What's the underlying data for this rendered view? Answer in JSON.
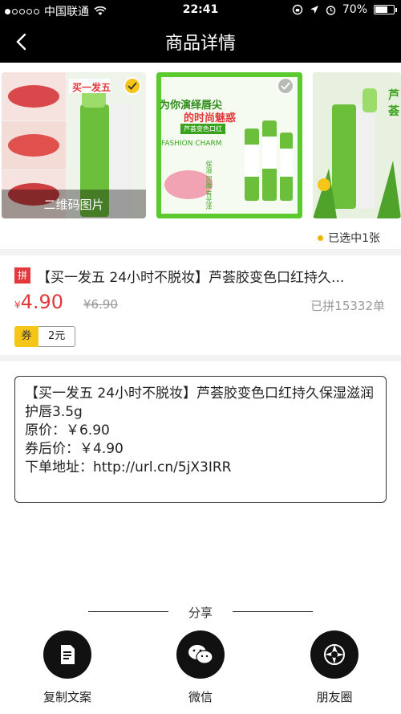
{
  "status_bar": {
    "carrier": "中国联通",
    "time": "22:41",
    "battery": "70%",
    "battery_level": 0.7
  },
  "nav": {
    "title": "商品详情"
  },
  "gallery": {
    "thumb1_caption": "二维码图片",
    "thumb1_badge": "买一发五",
    "thumb2_headline_1": "为你演绎唇尖",
    "thumb2_headline_2": "的时尚魅惑",
    "thumb2_label": "芦荟变色口红",
    "thumb2_tagline": "FASHION CHARM",
    "thumb2_features": "保湿 润唇 有光泽",
    "thumb3_text": "芦荟",
    "selected_count": "已选中1张"
  },
  "product": {
    "pin_badge": "拼",
    "title": "【买一发五 24小时不脱妆】芦荟胶变色口红持久...",
    "price_symbol": "¥",
    "price": "4.90",
    "original_price": "¥6.90",
    "sold": "已拼15332单",
    "coupon_tag": "券",
    "coupon_amount": "2元"
  },
  "copy_text": {
    "line1": "【买一发五 24小时不脱妆】芦荟胶变色口红持久保湿滋润护唇3.5g",
    "line2": "原价：￥6.90",
    "line3": "券后价：￥4.90",
    "line4": "下单地址：http://url.cn/5jX3IRR"
  },
  "share": {
    "label": "分享",
    "items": [
      {
        "label": "复制文案",
        "icon": "copy-document-icon"
      },
      {
        "label": "微信",
        "icon": "wechat-icon"
      },
      {
        "label": "朋友圈",
        "icon": "moments-icon"
      }
    ]
  },
  "colors": {
    "accent_red": "#e4393c",
    "coupon_yellow": "#f5c518",
    "header_black": "#000000"
  }
}
